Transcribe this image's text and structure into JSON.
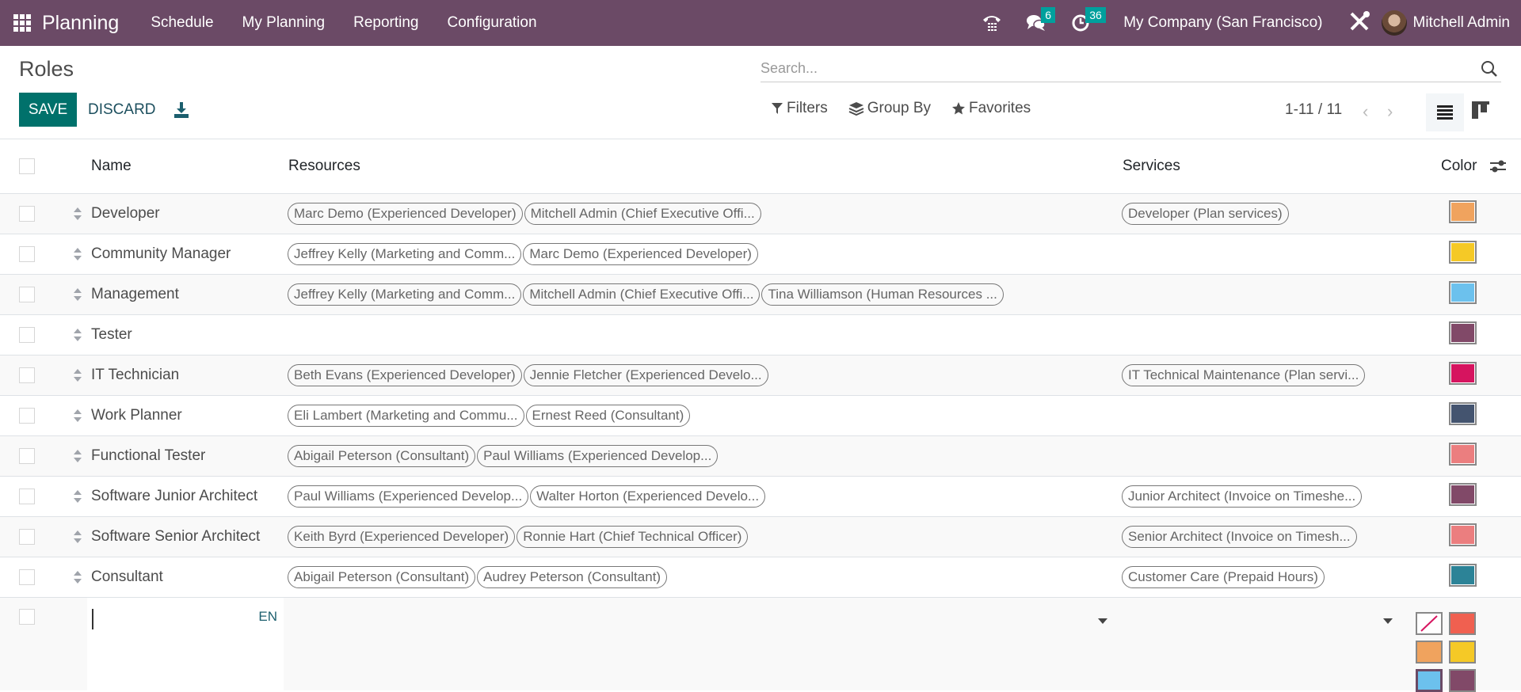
{
  "navbar": {
    "app_name": "Planning",
    "menu": [
      "Schedule",
      "My Planning",
      "Reporting",
      "Configuration"
    ],
    "messages_count": "6",
    "activities_count": "36",
    "company": "My Company (San Francisco)",
    "user": "Mitchell Admin"
  },
  "control_panel": {
    "title": "Roles",
    "save_label": "SAVE",
    "discard_label": "DISCARD",
    "search_placeholder": "Search...",
    "filters_label": "Filters",
    "groupby_label": "Group By",
    "favorites_label": "Favorites",
    "pager": "1-11 / 11"
  },
  "table": {
    "columns": {
      "name": "Name",
      "resources": "Resources",
      "services": "Services",
      "color": "Color"
    },
    "rows": [
      {
        "name": "Developer",
        "resources": [
          "Marc Demo (Experienced Developer)",
          "Mitchell Admin (Chief Executive Offi..."
        ],
        "services": [
          "Developer (Plan services)"
        ],
        "color": "#f0a35e"
      },
      {
        "name": "Community Manager",
        "resources": [
          "Jeffrey Kelly (Marketing and Comm...",
          "Marc Demo (Experienced Developer)"
        ],
        "services": [],
        "color": "#f5c926"
      },
      {
        "name": "Management",
        "resources": [
          "Jeffrey Kelly (Marketing and Comm...",
          "Mitchell Admin (Chief Executive Offi...",
          "Tina Williamson (Human Resources ..."
        ],
        "services": [],
        "color": "#6cc1ed"
      },
      {
        "name": "Tester",
        "resources": [],
        "services": [],
        "color": "#814968"
      },
      {
        "name": "IT Technician",
        "resources": [
          "Beth Evans (Experienced Developer)",
          "Jennie Fletcher (Experienced Develo..."
        ],
        "services": [
          "IT Technical Maintenance (Plan servi..."
        ],
        "color": "#d6145f"
      },
      {
        "name": "Work Planner",
        "resources": [
          "Eli Lambert (Marketing and Commu...",
          "Ernest Reed (Consultant)"
        ],
        "services": [],
        "color": "#44546f"
      },
      {
        "name": "Functional Tester",
        "resources": [
          "Abigail Peterson (Consultant)",
          "Paul Williams (Experienced Develop..."
        ],
        "services": [],
        "color": "#eb7e7f"
      },
      {
        "name": "Software Junior Architect",
        "resources": [
          "Paul Williams (Experienced Develop...",
          "Walter Horton (Experienced Develo..."
        ],
        "services": [
          "Junior Architect (Invoice on Timeshe..."
        ],
        "color": "#814968"
      },
      {
        "name": "Software Senior Architect",
        "resources": [
          "Keith Byrd (Experienced Developer)",
          "Ronnie Hart (Chief Technical Officer)"
        ],
        "services": [
          "Senior Architect (Invoice on Timesh..."
        ],
        "color": "#eb7e7f"
      },
      {
        "name": "Consultant",
        "resources": [
          "Abigail Peterson (Consultant)",
          "Audrey Peterson (Consultant)"
        ],
        "services": [
          "Customer Care (Prepaid Hours)"
        ],
        "color": "#2c8397"
      }
    ]
  },
  "edit_row": {
    "name_value": "",
    "lang_label": "EN",
    "color_options": [
      "none",
      "#f06050",
      "#f0a35e",
      "#f5c926",
      "#6cc1ed",
      "#814968"
    ],
    "selected_color": "#6cc1ed"
  },
  "colors": {
    "navbar": "#6b4a66",
    "primary": "#00716b",
    "badge": "#00a09d"
  }
}
